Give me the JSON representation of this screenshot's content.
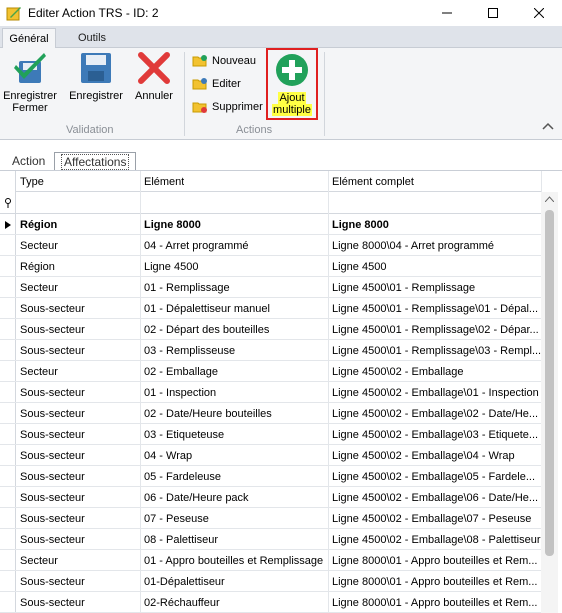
{
  "window": {
    "title": "Editer Action TRS - ID: 2",
    "minimize_icon": "minimize-icon",
    "maximize_icon": "maximize-icon",
    "close_icon": "close-icon"
  },
  "ribbon": {
    "tabs": [
      {
        "label": "Général",
        "active": true
      },
      {
        "label": "Outils",
        "active": false
      }
    ],
    "validation_group": {
      "label": "Validation",
      "buttons": [
        {
          "label_line1": "Enregistrer",
          "label_line2": "Fermer",
          "icon": "save-close-icon"
        },
        {
          "label_line1": "Enregistrer",
          "label_line2": "",
          "icon": "save-icon"
        },
        {
          "label_line1": "Annuler",
          "label_line2": "",
          "icon": "cancel-icon"
        }
      ]
    },
    "actions_group": {
      "label": "Actions",
      "small_buttons": [
        {
          "label": "Nouveau",
          "icon": "folder-new-icon"
        },
        {
          "label": "Editer",
          "icon": "folder-edit-icon"
        },
        {
          "label": "Supprimer",
          "icon": "folder-delete-icon"
        }
      ],
      "ajout": {
        "label_line1": "Ajout",
        "label_line2": "multiple",
        "icon": "add-multiple-icon"
      }
    },
    "accent_green": "#21a15a",
    "accent_red": "#e02020",
    "highlight_yellow": "#ffff44"
  },
  "subtabs": [
    {
      "label": "Action",
      "active": false
    },
    {
      "label": "Affectations",
      "active": true
    }
  ],
  "grid": {
    "columns": [
      "Type",
      "Elément",
      "Elément complet"
    ],
    "rows": [
      {
        "type": "Région",
        "element": "Ligne 8000",
        "complet": "Ligne 8000",
        "selected": true
      },
      {
        "type": "Secteur",
        "element": "04 - Arret programmé",
        "complet": "Ligne 8000\\04 - Arret programmé"
      },
      {
        "type": "Région",
        "element": "Ligne 4500",
        "complet": "Ligne 4500"
      },
      {
        "type": "Secteur",
        "element": "01 - Remplissage",
        "complet": "Ligne 4500\\01 - Remplissage"
      },
      {
        "type": "Sous-secteur",
        "element": "01 - Dépalettiseur manuel",
        "complet": "Ligne 4500\\01 - Remplissage\\01 - Dépal..."
      },
      {
        "type": "Sous-secteur",
        "element": "02 - Départ des bouteilles",
        "complet": "Ligne 4500\\01 - Remplissage\\02 - Dépar..."
      },
      {
        "type": "Sous-secteur",
        "element": "03 - Remplisseuse",
        "complet": "Ligne 4500\\01 - Remplissage\\03 - Rempl..."
      },
      {
        "type": "Secteur",
        "element": "02 - Emballage",
        "complet": "Ligne 4500\\02 - Emballage"
      },
      {
        "type": "Sous-secteur",
        "element": "01 - Inspection",
        "complet": "Ligne 4500\\02 - Emballage\\01 - Inspection"
      },
      {
        "type": "Sous-secteur",
        "element": "02 - Date/Heure bouteilles",
        "complet": "Ligne 4500\\02 - Emballage\\02 - Date/He..."
      },
      {
        "type": "Sous-secteur",
        "element": "03 - Etiqueteuse",
        "complet": "Ligne 4500\\02 - Emballage\\03 - Etiquete..."
      },
      {
        "type": "Sous-secteur",
        "element": "04 - Wrap",
        "complet": "Ligne 4500\\02 - Emballage\\04 - Wrap"
      },
      {
        "type": "Sous-secteur",
        "element": "05 - Fardeleuse",
        "complet": "Ligne 4500\\02 - Emballage\\05 - Fardele..."
      },
      {
        "type": "Sous-secteur",
        "element": "06 - Date/Heure pack",
        "complet": "Ligne 4500\\02 - Emballage\\06 - Date/He..."
      },
      {
        "type": "Sous-secteur",
        "element": "07 - Peseuse",
        "complet": "Ligne 4500\\02 - Emballage\\07 - Peseuse"
      },
      {
        "type": "Sous-secteur",
        "element": "08 - Palettiseur",
        "complet": "Ligne 4500\\02 - Emballage\\08 - Palettiseur"
      },
      {
        "type": "Secteur",
        "element": "01 - Appro bouteilles et Remplissage",
        "complet": "Ligne 8000\\01 - Appro bouteilles et Rem..."
      },
      {
        "type": "Sous-secteur",
        "element": "01-Dépalettiseur",
        "complet": "Ligne 8000\\01 - Appro bouteilles et Rem..."
      },
      {
        "type": "Sous-secteur",
        "element": "02-Réchauffeur",
        "complet": "Ligne 8000\\01 - Appro bouteilles et Rem..."
      }
    ]
  }
}
